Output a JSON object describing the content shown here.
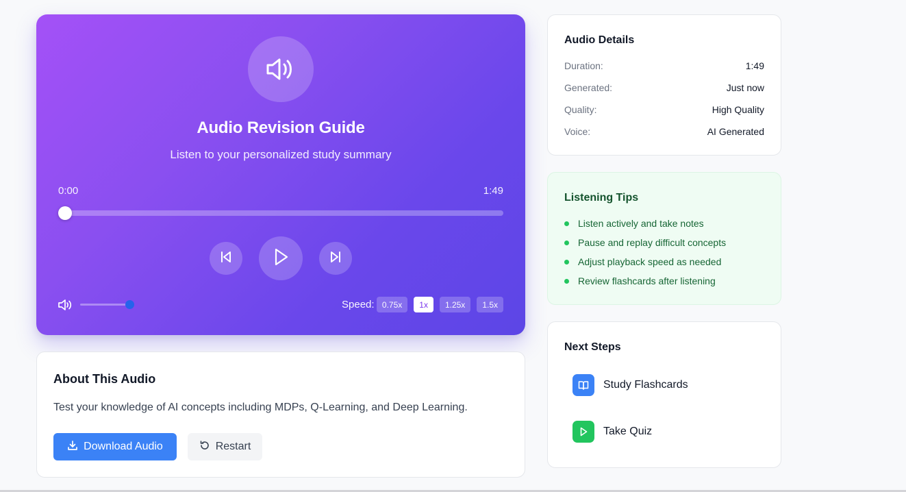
{
  "player": {
    "title": "Audio Revision Guide",
    "subtitle": "Listen to your personalized study summary",
    "current_time": "0:00",
    "total_time": "1:49",
    "progress_fraction": 0.0,
    "volume_fraction": 1.0,
    "speed_label": "Speed:",
    "speeds": [
      "0.75x",
      "1x",
      "1.25x",
      "1.5x"
    ],
    "active_speed": "1x",
    "icons": {
      "speaker": "speaker-icon",
      "prev": "skip-back-icon",
      "play": "play-icon",
      "next": "skip-forward-icon",
      "volume": "volume-icon"
    }
  },
  "about": {
    "title": "About This Audio",
    "description": "Test your knowledge of AI concepts including MDPs, Q-Learning, and Deep Learning.",
    "download_label": "Download Audio",
    "restart_label": "Restart"
  },
  "details": {
    "title": "Audio Details",
    "rows": [
      {
        "key": "Duration:",
        "value": "1:49"
      },
      {
        "key": "Generated:",
        "value": "Just now"
      },
      {
        "key": "Quality:",
        "value": "High Quality"
      },
      {
        "key": "Voice:",
        "value": "AI Generated"
      }
    ]
  },
  "tips": {
    "title": "Listening Tips",
    "items": [
      "Listen actively and take notes",
      "Pause and replay difficult concepts",
      "Adjust playback speed as needed",
      "Review flashcards after listening"
    ]
  },
  "next_steps": {
    "title": "Next Steps",
    "items": [
      {
        "label": "Study Flashcards",
        "icon": "book-icon",
        "color": "#3b82f6"
      },
      {
        "label": "Take Quiz",
        "icon": "play-icon",
        "color": "#22c55e"
      }
    ]
  },
  "colors": {
    "accent_purple": "#7c3aed",
    "primary_blue": "#3b82f6",
    "success_green": "#22c55e"
  }
}
